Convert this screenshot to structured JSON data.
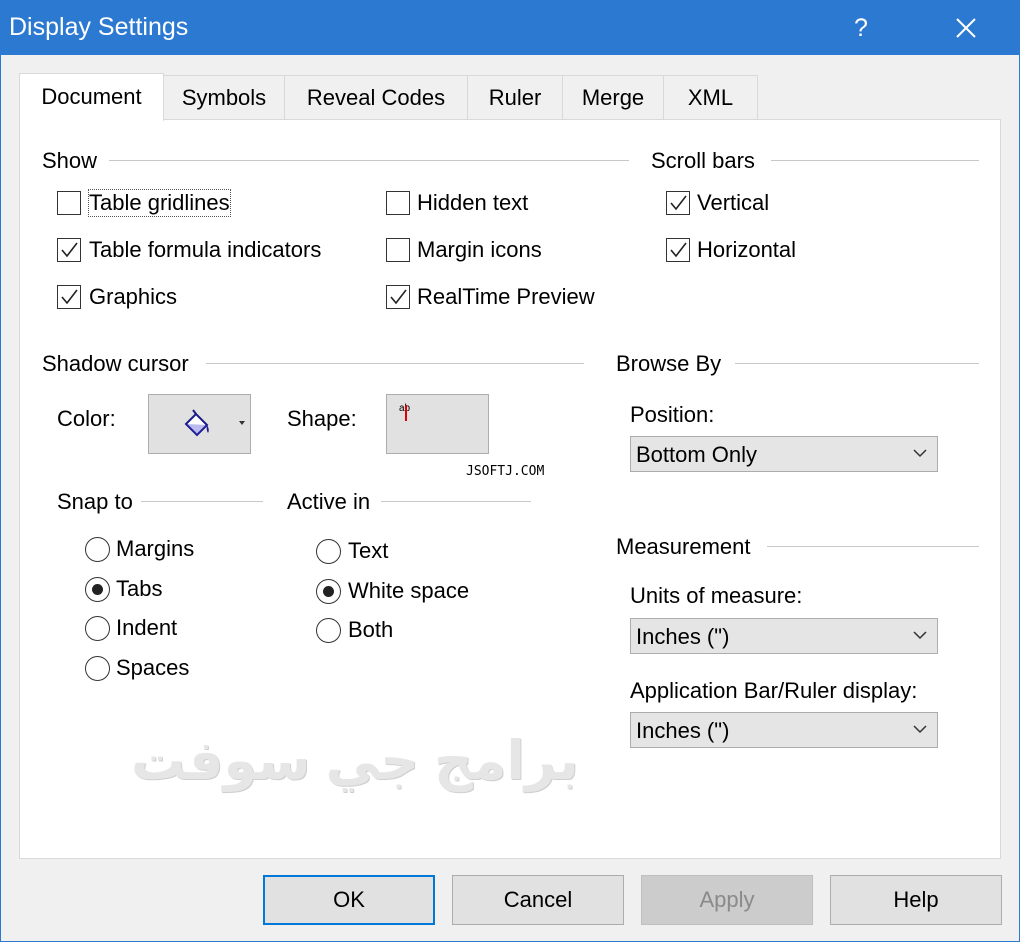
{
  "window": {
    "title": "Display Settings",
    "help_glyph": "?"
  },
  "tabs": [
    "Document",
    "Symbols",
    "Reveal Codes",
    "Ruler",
    "Merge",
    "XML"
  ],
  "show": {
    "title": "Show",
    "items": [
      {
        "label": "Table gridlines",
        "checked": false
      },
      {
        "label": "Table formula indicators",
        "checked": true
      },
      {
        "label": "Graphics",
        "checked": true
      },
      {
        "label": "Hidden text",
        "checked": false
      },
      {
        "label": "Margin icons",
        "checked": false
      },
      {
        "label": "RealTime Preview",
        "checked": true
      }
    ]
  },
  "scrollbars": {
    "title": "Scroll bars",
    "items": [
      {
        "label": "Vertical",
        "checked": true
      },
      {
        "label": "Horizontal",
        "checked": true
      }
    ]
  },
  "shadow_cursor": {
    "title": "Shadow cursor",
    "color_label": "Color:",
    "shape_label": "Shape:",
    "shape_sample": "ab"
  },
  "snap_to": {
    "title": "Snap to",
    "options": [
      "Margins",
      "Tabs",
      "Indent",
      "Spaces"
    ],
    "selected": "Tabs"
  },
  "active_in": {
    "title": "Active in",
    "options": [
      "Text",
      "White space",
      "Both"
    ],
    "selected": "White space"
  },
  "browse_by": {
    "title": "Browse By",
    "position_label": "Position:",
    "position_value": "Bottom Only"
  },
  "measurement": {
    "title": "Measurement",
    "units_label": "Units of measure:",
    "units_value": "Inches (\")",
    "appbar_label": "Application Bar/Ruler display:",
    "appbar_value": "Inches (\")"
  },
  "buttons": {
    "ok": "OK",
    "cancel": "Cancel",
    "apply": "Apply",
    "help": "Help"
  },
  "watermarks": {
    "small": "JSOFTJ.COM",
    "big": "برامج جي سوفت"
  }
}
